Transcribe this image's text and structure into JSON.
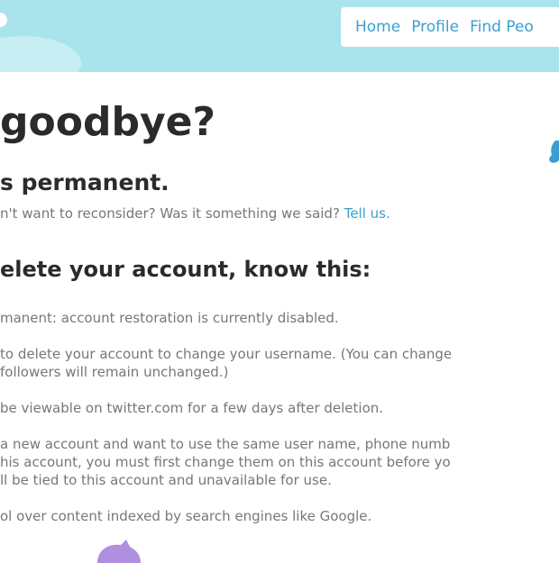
{
  "nav": {
    "items": [
      "Home",
      "Profile",
      "Find Peo"
    ]
  },
  "page": {
    "title": "goodbye?",
    "subtitle": "s permanent.",
    "reconsider_text": "n't want to reconsider? Was it something we said?",
    "reconsider_link": "Tell us.",
    "section_heading": "elete your account, know this:"
  },
  "facts": [
    [
      "manent: account restoration is currently disabled."
    ],
    [
      "to delete your account to change your username. (You can change",
      "followers will remain unchanged.)"
    ],
    [
      "be viewable on twitter.com for a few days after deletion."
    ],
    [
      "a new account and want to use the same user name, phone numb",
      "his account, you must first change them on this account before yo",
      "ll be tied to this account and unavailable for use."
    ],
    [
      "ol over content indexed by search engines like Google."
    ]
  ],
  "colors": {
    "header_bg": "#a9e3eb",
    "link": "#3a9fd0",
    "heading": "#2b2b2b",
    "body_text": "#777777",
    "bird_blue": "#3a9fd0",
    "bird_purple": "#b08ee0"
  }
}
